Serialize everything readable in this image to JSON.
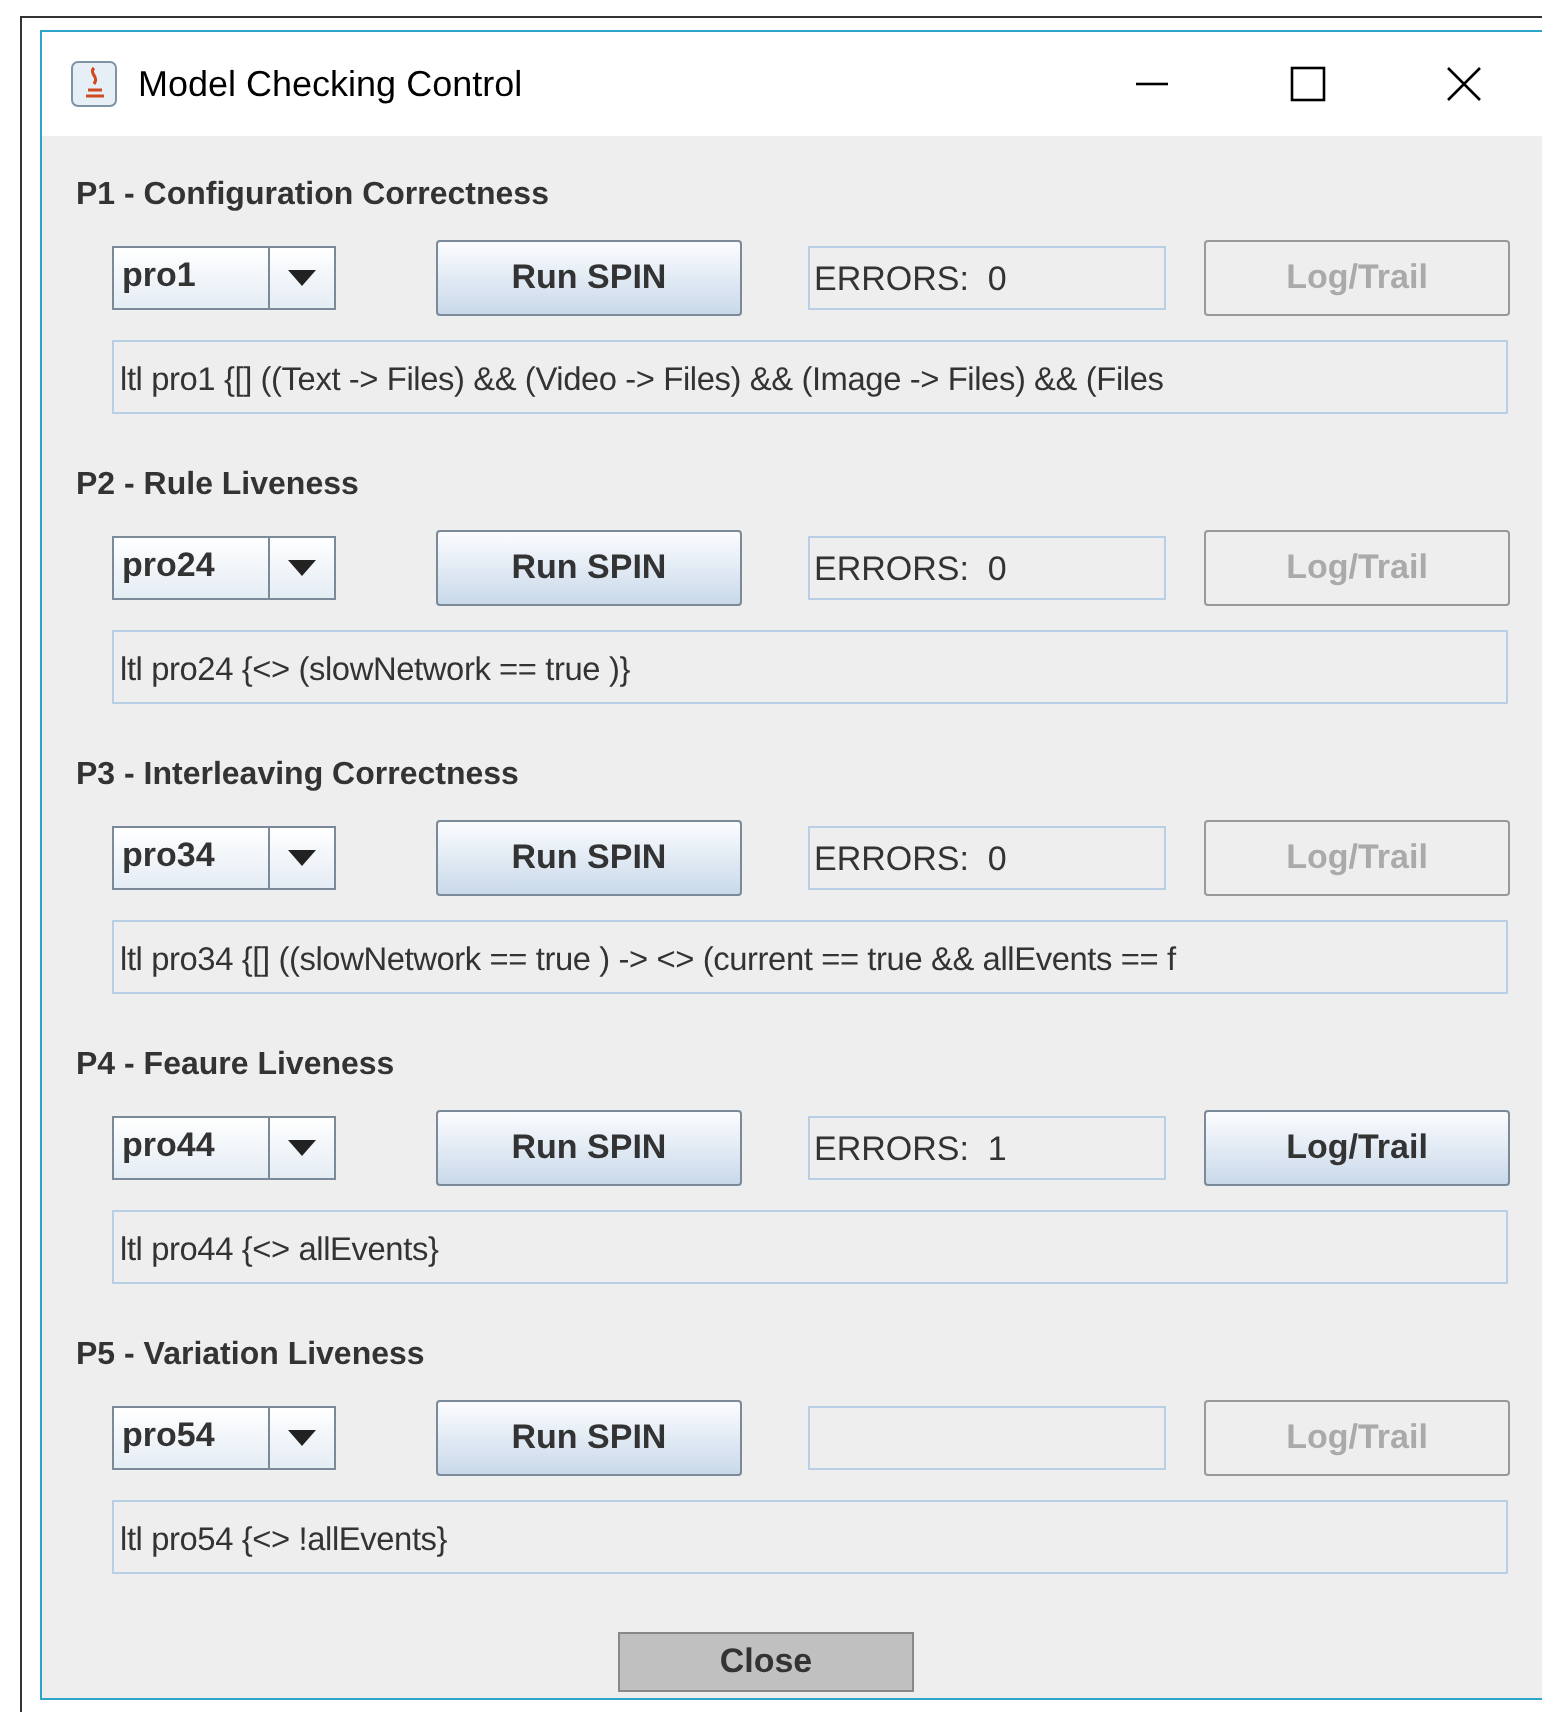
{
  "window": {
    "title": "Model Checking Control"
  },
  "sections": [
    {
      "title": "P1 - Configuration Correctness",
      "property": "pro1",
      "run_button": "Run SPIN",
      "errors": "ERRORS:  0",
      "log_button": {
        "label": "Log/Trail",
        "disabled": true
      },
      "formula": "ltl pro1 {[] ((Text -> Files) && (Video -> Files) && (Image -> Files) && (Files"
    },
    {
      "title": "P2 - Rule Liveness",
      "property": "pro24",
      "run_button": "Run SPIN",
      "errors": "ERRORS:  0",
      "log_button": {
        "label": "Log/Trail",
        "disabled": true
      },
      "formula": "ltl pro24 {<> (slowNetwork == true )}"
    },
    {
      "title": "P3 - Interleaving Correctness",
      "property": "pro34",
      "run_button": "Run SPIN",
      "errors": "ERRORS:  0",
      "log_button": {
        "label": "Log/Trail",
        "disabled": true
      },
      "formula": "ltl pro34 {[] ((slowNetwork == true ) -> <> (current == true && allEvents == f"
    },
    {
      "title": "P4 - Feaure Liveness",
      "property": "pro44",
      "run_button": "Run SPIN",
      "errors": "ERRORS:  1",
      "log_button": {
        "label": "Log/Trail",
        "disabled": false
      },
      "formula": "ltl pro44 {<> allEvents}"
    },
    {
      "title": "P5 - Variation Liveness",
      "property": "pro54",
      "run_button": "Run SPIN",
      "log_button": {
        "label": "Log/Trail",
        "disabled": true
      },
      "formula": "ltl pro54 {<> !allEvents}"
    }
  ],
  "close_button": "Close"
}
